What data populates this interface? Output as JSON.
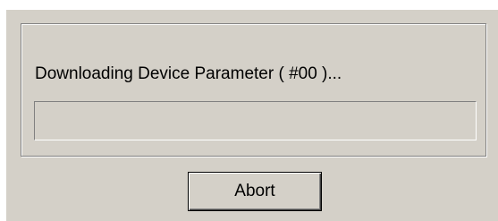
{
  "dialog": {
    "status_text": "Downloading Device Parameter ( #00 )...",
    "progress": 0,
    "abort_label": "Abort"
  },
  "colors": {
    "face": "#d4d0c8",
    "shadow": "#808080",
    "highlight": "#ffffff",
    "progress_fill": "#000080"
  }
}
